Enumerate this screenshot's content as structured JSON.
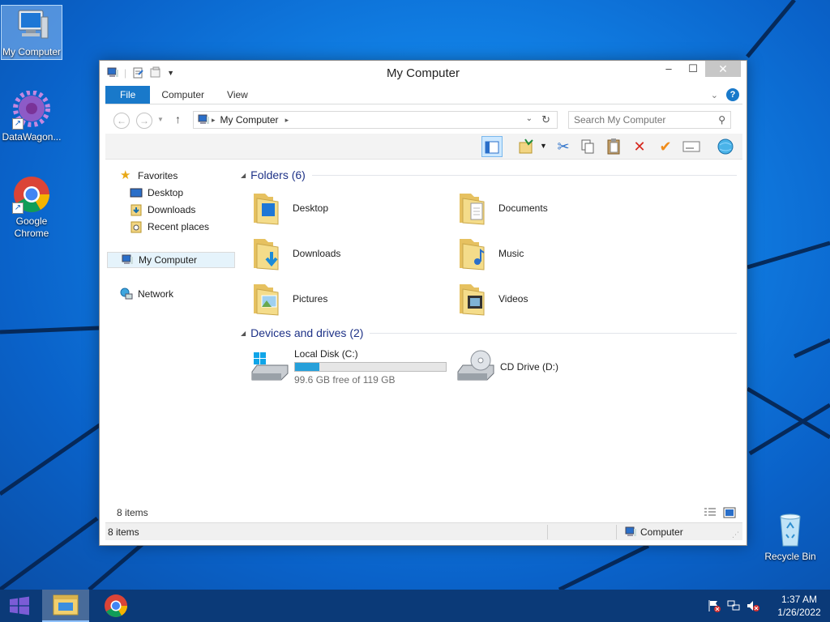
{
  "desktop": {
    "icons": [
      {
        "label": "My Computer",
        "icon": "computer-icon"
      },
      {
        "label": "DataWagon...",
        "icon": "gear-icon"
      },
      {
        "label": "Google Chrome",
        "icon": "chrome-icon"
      },
      {
        "label": "Recycle Bin",
        "icon": "recycle-bin-icon"
      }
    ]
  },
  "window": {
    "title": "My Computer",
    "ribbon_tabs": [
      "File",
      "Computer",
      "View"
    ],
    "address": {
      "path": "My Computer"
    },
    "search": {
      "placeholder": "Search My Computer"
    },
    "nav": {
      "favorites": "Favorites",
      "desktop": "Desktop",
      "downloads": "Downloads",
      "recent": "Recent places",
      "my_computer": "My Computer",
      "network": "Network"
    },
    "folders_header": "Folders (6)",
    "folders": [
      "Desktop",
      "Documents",
      "Downloads",
      "Music",
      "Pictures",
      "Videos"
    ],
    "devices_header": "Devices and drives (2)",
    "drives": [
      {
        "name": "Local Disk (C:)",
        "free_text": "99.6 GB free of 119 GB",
        "used_fraction": 0.163
      },
      {
        "name": "CD Drive (D:)"
      }
    ],
    "item_count": "8 items",
    "status": {
      "count": "8 items",
      "location": "Computer"
    }
  },
  "taskbar": {
    "time": "1:37 AM",
    "date": "1/26/2022"
  },
  "colors": {
    "accent": "#1979ca",
    "taskbar": "#0b3a78",
    "drive_bar": "#26a0da"
  }
}
